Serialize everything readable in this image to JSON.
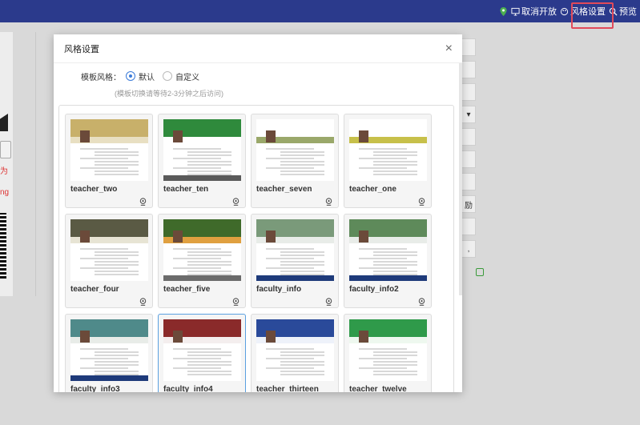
{
  "topbar": {
    "actions": [
      {
        "label": "",
        "icon": "location-pin-icon"
      },
      {
        "label": "取消开放",
        "icon": "monitor-icon"
      },
      {
        "label": "风格设置",
        "icon": "palette-icon"
      },
      {
        "label": "预览",
        "icon": "search-icon"
      }
    ]
  },
  "background": {
    "red_texts": [
      "为",
      "ng"
    ],
    "right_field_texts": [
      "励",
      ","
    ]
  },
  "modal": {
    "title": "风格设置",
    "mode_label": "模板风格：",
    "options": [
      {
        "label": "默认",
        "checked": true
      },
      {
        "label": "自定义",
        "checked": false
      }
    ],
    "hint": "(模板切换请等待2-3分钟之后访问)",
    "templates": [
      {
        "name": "teacher_two",
        "style": "wheat",
        "selected": false
      },
      {
        "name": "teacher_ten",
        "style": "green",
        "selected": false
      },
      {
        "name": "teacher_seven",
        "style": "field",
        "selected": false
      },
      {
        "name": "teacher_one",
        "style": "rice",
        "selected": false
      },
      {
        "name": "teacher_four",
        "style": "olive",
        "selected": false
      },
      {
        "name": "teacher_five",
        "style": "sunset",
        "selected": false
      },
      {
        "name": "faculty_info",
        "style": "campus",
        "selected": false
      },
      {
        "name": "faculty_info2",
        "style": "campus-green",
        "selected": false
      },
      {
        "name": "faculty_info3",
        "style": "campus-teal",
        "selected": false
      },
      {
        "name": "faculty_info4",
        "style": "red-banner",
        "selected": true
      },
      {
        "name": "teacher_thirteen",
        "style": "blue",
        "selected": false
      },
      {
        "name": "teacher_twelve",
        "style": "green-light",
        "selected": false
      }
    ]
  },
  "colors": {
    "topbar": "#2b3a8c",
    "accent": "#3b7bd9",
    "highlight": "#e04a5a",
    "selected_border": "#5aa0e0"
  }
}
